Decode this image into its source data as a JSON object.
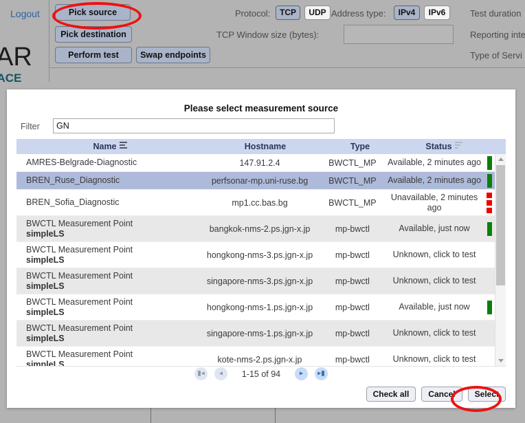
{
  "app": {
    "brand_line1": "AR",
    "brand_line2": "FACE",
    "logout_label": "Logout"
  },
  "toolbar": {
    "pick_source_label": "Pick source",
    "pick_destination_label": "Pick destination",
    "perform_test_label": "Perform test",
    "swap_endpoints_label": "Swap endpoints"
  },
  "settings": {
    "protocol_label": "Protocol:",
    "protocol_tcp": "TCP",
    "protocol_udp": "UDP",
    "address_type_label": "Address type:",
    "address_ipv4": "IPv4",
    "address_ipv6": "IPv6",
    "test_duration_label": "Test duration",
    "tcp_window_label": "TCP Window size (bytes):",
    "tcp_window_value": "",
    "reporting_interval_label": "Reporting inte",
    "type_of_service_label": "Type of Servi"
  },
  "dialog": {
    "title": "Please select measurement source",
    "filter_label": "Filter",
    "filter_value": "GN",
    "filter_placeholder": "",
    "columns": {
      "name": "Name",
      "hostname": "Hostname",
      "type": "Type",
      "status": "Status"
    },
    "rows": [
      {
        "name": "AMRES-Belgrade-Diagnostic",
        "name_sub": "",
        "hostname": "147.91.2.4",
        "type": "BWCTL_MP",
        "status": "Available, 2 minutes ago",
        "led": "green",
        "selected": false,
        "alt": false
      },
      {
        "name": "BREN_Ruse_Diagnostic",
        "name_sub": "",
        "hostname": "perfsonar-mp.uni-ruse.bg",
        "type": "BWCTL_MP",
        "status": "Available, 2 minutes ago",
        "led": "green",
        "selected": true,
        "alt": false
      },
      {
        "name": "BREN_Sofia_Diagnostic",
        "name_sub": "",
        "hostname": "mp1.cc.bas.bg",
        "type": "BWCTL_MP",
        "status": "Unavailable, 2 minutes ago",
        "led": "red3",
        "selected": false,
        "alt": false
      },
      {
        "name": "BWCTL Measurement Point",
        "name_sub": "simpleLS",
        "hostname": "bangkok-nms-2.ps.jgn-x.jp",
        "type": "mp-bwctl",
        "status": "Available, just now",
        "led": "green",
        "selected": false,
        "alt": true
      },
      {
        "name": "BWCTL Measurement Point",
        "name_sub": "simpleLS",
        "hostname": "hongkong-nms-3.ps.jgn-x.jp",
        "type": "mp-bwctl",
        "status": "Unknown, click to test",
        "led": "none",
        "selected": false,
        "alt": false
      },
      {
        "name": "BWCTL Measurement Point",
        "name_sub": "simpleLS",
        "hostname": "singapore-nms-3.ps.jgn-x.jp",
        "type": "mp-bwctl",
        "status": "Unknown, click to test",
        "led": "none",
        "selected": false,
        "alt": true
      },
      {
        "name": "BWCTL Measurement Point",
        "name_sub": "simpleLS",
        "hostname": "hongkong-nms-1.ps.jgn-x.jp",
        "type": "mp-bwctl",
        "status": "Available, just now",
        "led": "green",
        "selected": false,
        "alt": false
      },
      {
        "name": "BWCTL Measurement Point",
        "name_sub": "simpleLS",
        "hostname": "singapore-nms-1.ps.jgn-x.jp",
        "type": "mp-bwctl",
        "status": "Unknown, click to test",
        "led": "none",
        "selected": false,
        "alt": true
      },
      {
        "name": "BWCTL Measurement Point",
        "name_sub": "simpleLS",
        "hostname": "kote-nms-2.ps.jgn-x.jp",
        "type": "mp-bwctl",
        "status": "Unknown, click to test",
        "led": "none",
        "selected": false,
        "alt": false
      }
    ],
    "pager": {
      "first_icon": "first-page-icon",
      "prev_icon": "previous-page-icon",
      "info": "1-15 of 94",
      "next_icon": "next-page-icon",
      "last_icon": "last-page-icon"
    },
    "buttons": {
      "check_all": "Check all",
      "cancel": "Cancel",
      "select": "Select"
    }
  },
  "colors": {
    "accent": "#aab4c8",
    "header": "#ccd6ee",
    "selected_row": "#aebada",
    "status_available": "#0a7f0a",
    "status_unavailable": "#f00000",
    "annotation": "#ee1111",
    "page_background": "#b3b3b3"
  }
}
